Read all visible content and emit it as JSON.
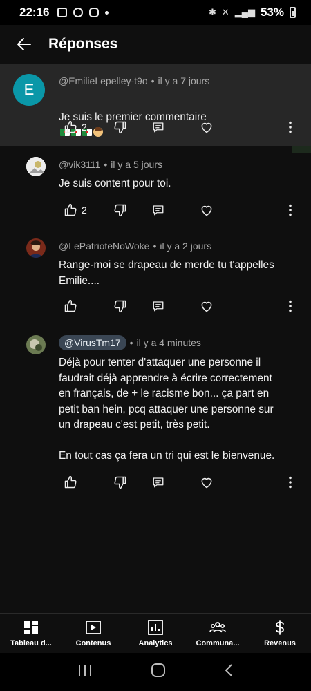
{
  "status_bar": {
    "time": "22:16",
    "battery": "53%"
  },
  "header": {
    "title": "Réponses"
  },
  "comments": [
    {
      "author": "@EmilieLepelley-t9o",
      "separator": "•",
      "time": "il y a 7 jours",
      "avatar_letter": "E",
      "text": "Je suis le premier commentaire",
      "likes": "2",
      "highlighted": true
    },
    {
      "author": "@vik3111",
      "separator": "•",
      "time": "il y a 5 jours",
      "text": "Je suis content pour toi.",
      "likes": "2"
    },
    {
      "author": "@LePatrioteNoWoke",
      "separator": "•",
      "time": "il y a 2 jours",
      "text": "Range-moi se drapeau de merde tu t'appelles\nEmilie....",
      "likes": ""
    },
    {
      "author": "@VirusTm17",
      "separator": "•",
      "time": "il y a 4 minutes",
      "text": "Déjà pour tenter d'attaquer une personne il\nfaudrait déjà apprendre à écrire correctement\nen français, de + le racisme bon... ça part en\npetit ban hein, pcq attaquer une personne sur\nun drapeau c'est petit, très petit.\n\nEn tout cas ça fera un tri qui est le bienvenue.",
      "likes": ""
    }
  ],
  "bottom_nav": [
    {
      "label": "Tableau d...",
      "icon": "dashboard-icon"
    },
    {
      "label": "Contenus",
      "icon": "play-icon"
    },
    {
      "label": "Analytics",
      "icon": "analytics-icon"
    },
    {
      "label": "Communa...",
      "icon": "community-icon"
    },
    {
      "label": "Revenus",
      "icon": "dollar-icon"
    }
  ],
  "colors": {
    "background": "#0f0f0f",
    "highlight": "#272727",
    "avatar_e": "#0a97a8",
    "pill": "#3a4654"
  }
}
